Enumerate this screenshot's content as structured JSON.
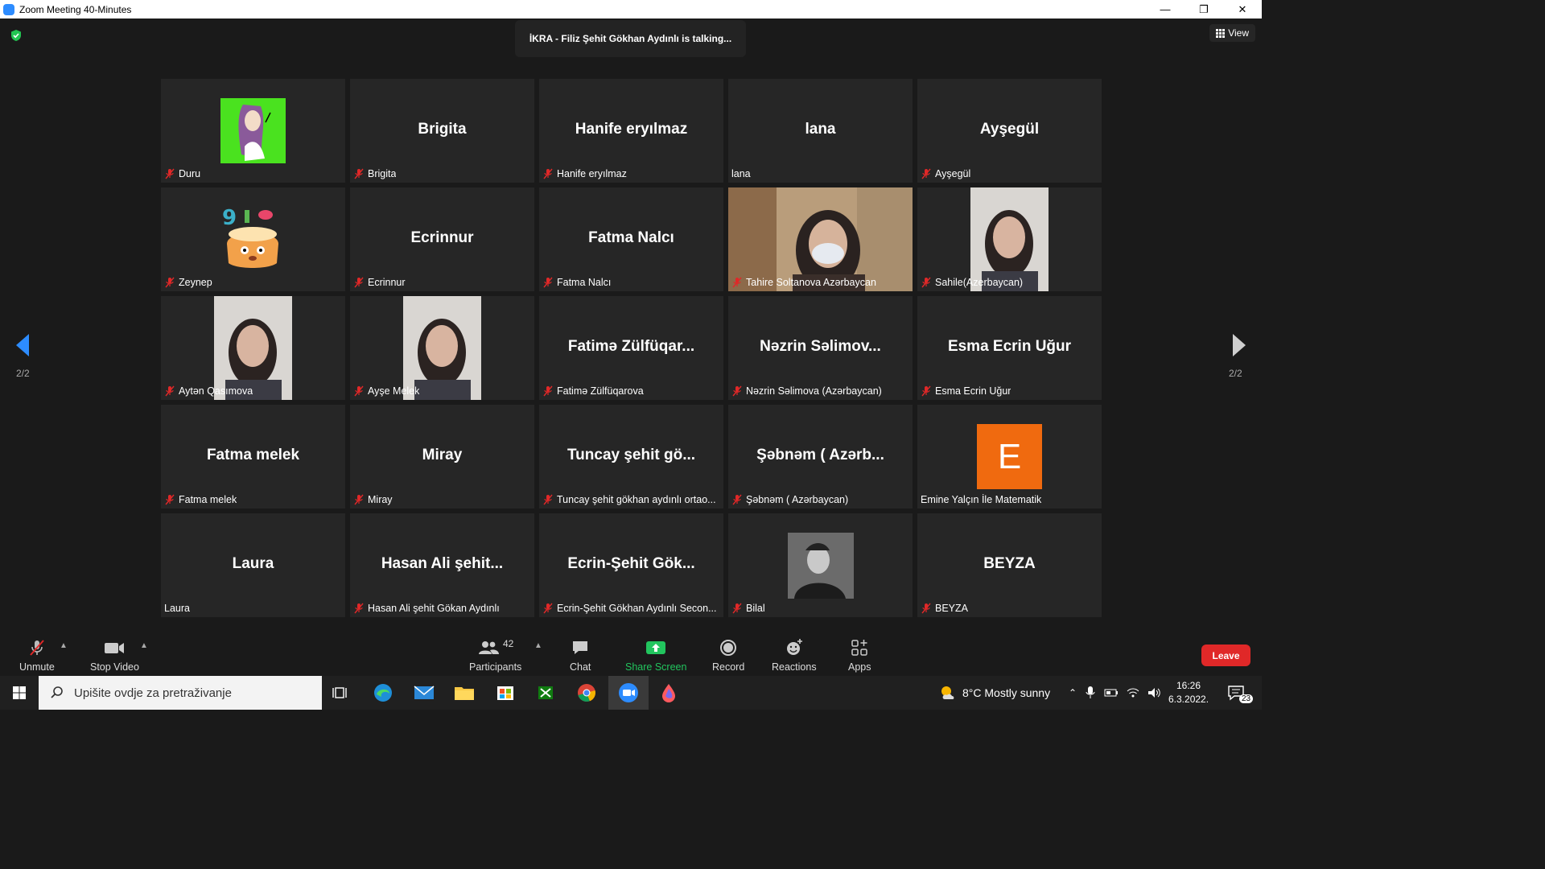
{
  "window": {
    "title": "Zoom Meeting 40-Minutes"
  },
  "meeting": {
    "talking_banner": "İKRA - Filiz Şehit Gökhan Aydınlı is talking...",
    "view_label": "View",
    "page_left": "2/2",
    "page_right": "2/2"
  },
  "tiles": [
    {
      "display": "",
      "label": "Duru",
      "muted": true,
      "type": "avatar-cartoon"
    },
    {
      "display": "Brigita",
      "label": "Brigita",
      "muted": true,
      "type": "name"
    },
    {
      "display": "Hanife eryılmaz",
      "label": "Hanife eryılmaz",
      "muted": true,
      "type": "name"
    },
    {
      "display": "lana",
      "label": "lana",
      "muted": false,
      "type": "name"
    },
    {
      "display": "Ayşegül",
      "label": "Ayşegül",
      "muted": true,
      "type": "name"
    },
    {
      "display": "",
      "label": "Zeynep",
      "muted": true,
      "type": "avatar-cake"
    },
    {
      "display": "Ecrinnur",
      "label": "Ecrinnur",
      "muted": true,
      "type": "name"
    },
    {
      "display": "Fatma Nalcı",
      "label": "Fatma Nalcı",
      "muted": true,
      "type": "name"
    },
    {
      "display": "",
      "label": "Tahire Soltanova Azərbaycan",
      "muted": true,
      "type": "video-full"
    },
    {
      "display": "",
      "label": "Sahile(Azerbaycan)",
      "muted": true,
      "type": "video-narrow"
    },
    {
      "display": "",
      "label": "Aytən Qasımova",
      "muted": true,
      "type": "video-narrow"
    },
    {
      "display": "",
      "label": "Ayşe Melek",
      "muted": true,
      "type": "video-narrow"
    },
    {
      "display": "Fatimə Zülfüqar...",
      "label": "Fatimə Zülfüqarova",
      "muted": true,
      "type": "name"
    },
    {
      "display": "Nəzrin Səlimov...",
      "label": "Nəzrin Səlimova (Azərbaycan)",
      "muted": true,
      "type": "name"
    },
    {
      "display": "Esma Ecrin Uğur",
      "label": "Esma Ecrin Uğur",
      "muted": true,
      "type": "name"
    },
    {
      "display": "Fatma melek",
      "label": "Fatma melek",
      "muted": true,
      "type": "name"
    },
    {
      "display": "Miray",
      "label": "Miray",
      "muted": true,
      "type": "name"
    },
    {
      "display": "Tuncay şehit gö...",
      "label": "Tuncay şehit gökhan aydınlı ortao...",
      "muted": true,
      "type": "name"
    },
    {
      "display": "Şəbnəm ( Azərb...",
      "label": "Şəbnəm ( Azərbaycan)",
      "muted": true,
      "type": "name"
    },
    {
      "display": "E",
      "label": "Emine Yalçın İle Matematik",
      "muted": false,
      "type": "avatar-letter"
    },
    {
      "display": "Laura",
      "label": "Laura",
      "muted": false,
      "type": "name"
    },
    {
      "display": "Hasan Ali şehit...",
      "label": "Hasan Ali şehit Gökan Aydınlı",
      "muted": true,
      "type": "name"
    },
    {
      "display": "Ecrin-Şehit Gök...",
      "label": "Ecrin-Şehit Gökhan Aydınlı Secon...",
      "muted": true,
      "type": "name"
    },
    {
      "display": "",
      "label": "Bilal",
      "muted": true,
      "type": "avatar-photo"
    },
    {
      "display": "BEYZA",
      "label": "BEYZA",
      "muted": true,
      "type": "name"
    }
  ],
  "toolbar": {
    "unmute": "Unmute",
    "stop_video": "Stop Video",
    "participants": "Participants",
    "participant_count": "42",
    "chat": "Chat",
    "share_screen": "Share Screen",
    "record": "Record",
    "reactions": "Reactions",
    "apps": "Apps",
    "leave": "Leave"
  },
  "taskbar": {
    "search_placeholder": "Upišite ovdje za pretraživanje",
    "weather": "8°C  Mostly sunny",
    "time": "16:26",
    "date": "6.3.2022.",
    "notifications": "23"
  },
  "colors": {
    "accent": "#2d8cff",
    "share": "#22c55e",
    "leave": "#e02828",
    "muted_mic": "#e02828",
    "tile": "#262626",
    "letter_avatar": "#f06a0f"
  }
}
